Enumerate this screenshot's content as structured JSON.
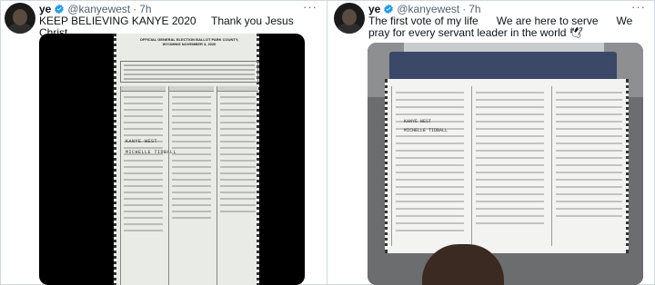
{
  "left_tweet": {
    "user": {
      "name": "ye",
      "handle": "@kanyewest",
      "time": "7h"
    },
    "more_label": "···",
    "text": "KEEP BELIEVING KANYE 2020     Thank you Jesus Christ",
    "ballot": {
      "title": "OFFICIAL GENERAL ELECTION BALLOT PARK COUNTY, WYOMING NOVEMBER 3, 2020",
      "write_in_president": "KANYE WEST",
      "write_in_vp": "MICHELLE TIDBALL"
    }
  },
  "right_tweet": {
    "user": {
      "name": "ye",
      "handle": "@kanyewest",
      "time": "7h"
    },
    "more_label": "···",
    "text": "The first vote of my life      We are here to serve      We pray for every servant leader in the world 🕊",
    "ballot": {
      "write_in_president": "KANYE WEST",
      "write_in_vp": "MICHELLE TIDBALL"
    }
  },
  "colors": {
    "verified": "#1d9bf0",
    "muted": "#536471",
    "border": "#cfd9de"
  }
}
